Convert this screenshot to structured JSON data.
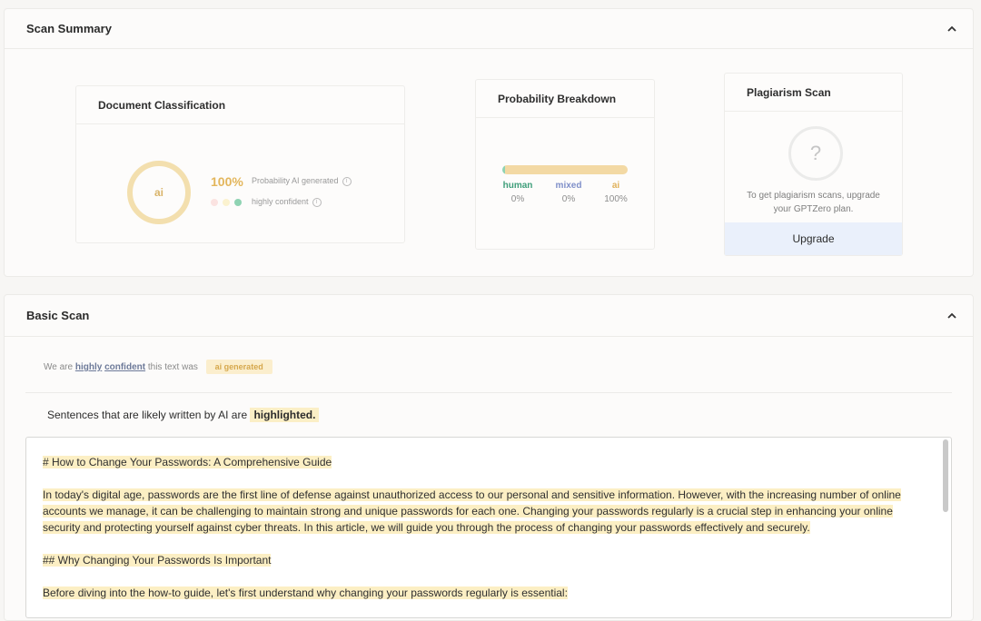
{
  "scan_summary": {
    "title": "Scan Summary",
    "doc_class": {
      "title": "Document Classification",
      "gauge_label": "ai",
      "percent": "100%",
      "prob_label": "Probability AI generated",
      "confidence_label": "highly confident"
    },
    "prob_breakdown": {
      "title": "Probability Breakdown",
      "labels": [
        "human",
        "mixed",
        "ai"
      ],
      "values": [
        "0%",
        "0%",
        "100%"
      ],
      "label_colors": [
        "#3e9e7a",
        "#7f8fc9",
        "#e0b15a"
      ],
      "ai_fraction": 1.0
    },
    "plagiarism": {
      "title": "Plagiarism Scan",
      "icon": "?",
      "message_line1": "To get plagiarism scans, upgrade",
      "message_line2": "your GPTZero plan.",
      "upgrade_label": "Upgrade"
    }
  },
  "basic_scan": {
    "title": "Basic Scan",
    "confident_prefix": "We are",
    "confident_word1": "highly",
    "confident_word2": "confident",
    "confident_mid": "this text was",
    "badge": "ai generated",
    "likely_text": "Sentences that are likely written by AI are",
    "likely_highlight": "highlighted.",
    "text": {
      "heading1": "# How to Change Your Passwords: A Comprehensive Guide",
      "para1": "In today's digital age, passwords are the first line of defense against unauthorized access to our personal and sensitive information. However, with the increasing number of online accounts we manage, it can be challenging to maintain strong and unique passwords for each one. Changing your passwords regularly is a crucial step in enhancing your online security and protecting yourself against cyber threats. In this article, we will guide you through the process of changing your passwords effectively and securely.",
      "heading2": "## Why Changing Your Passwords Is Important",
      "para2": "Before diving into the how-to guide, let's first understand why changing your passwords regularly is essential:"
    }
  }
}
